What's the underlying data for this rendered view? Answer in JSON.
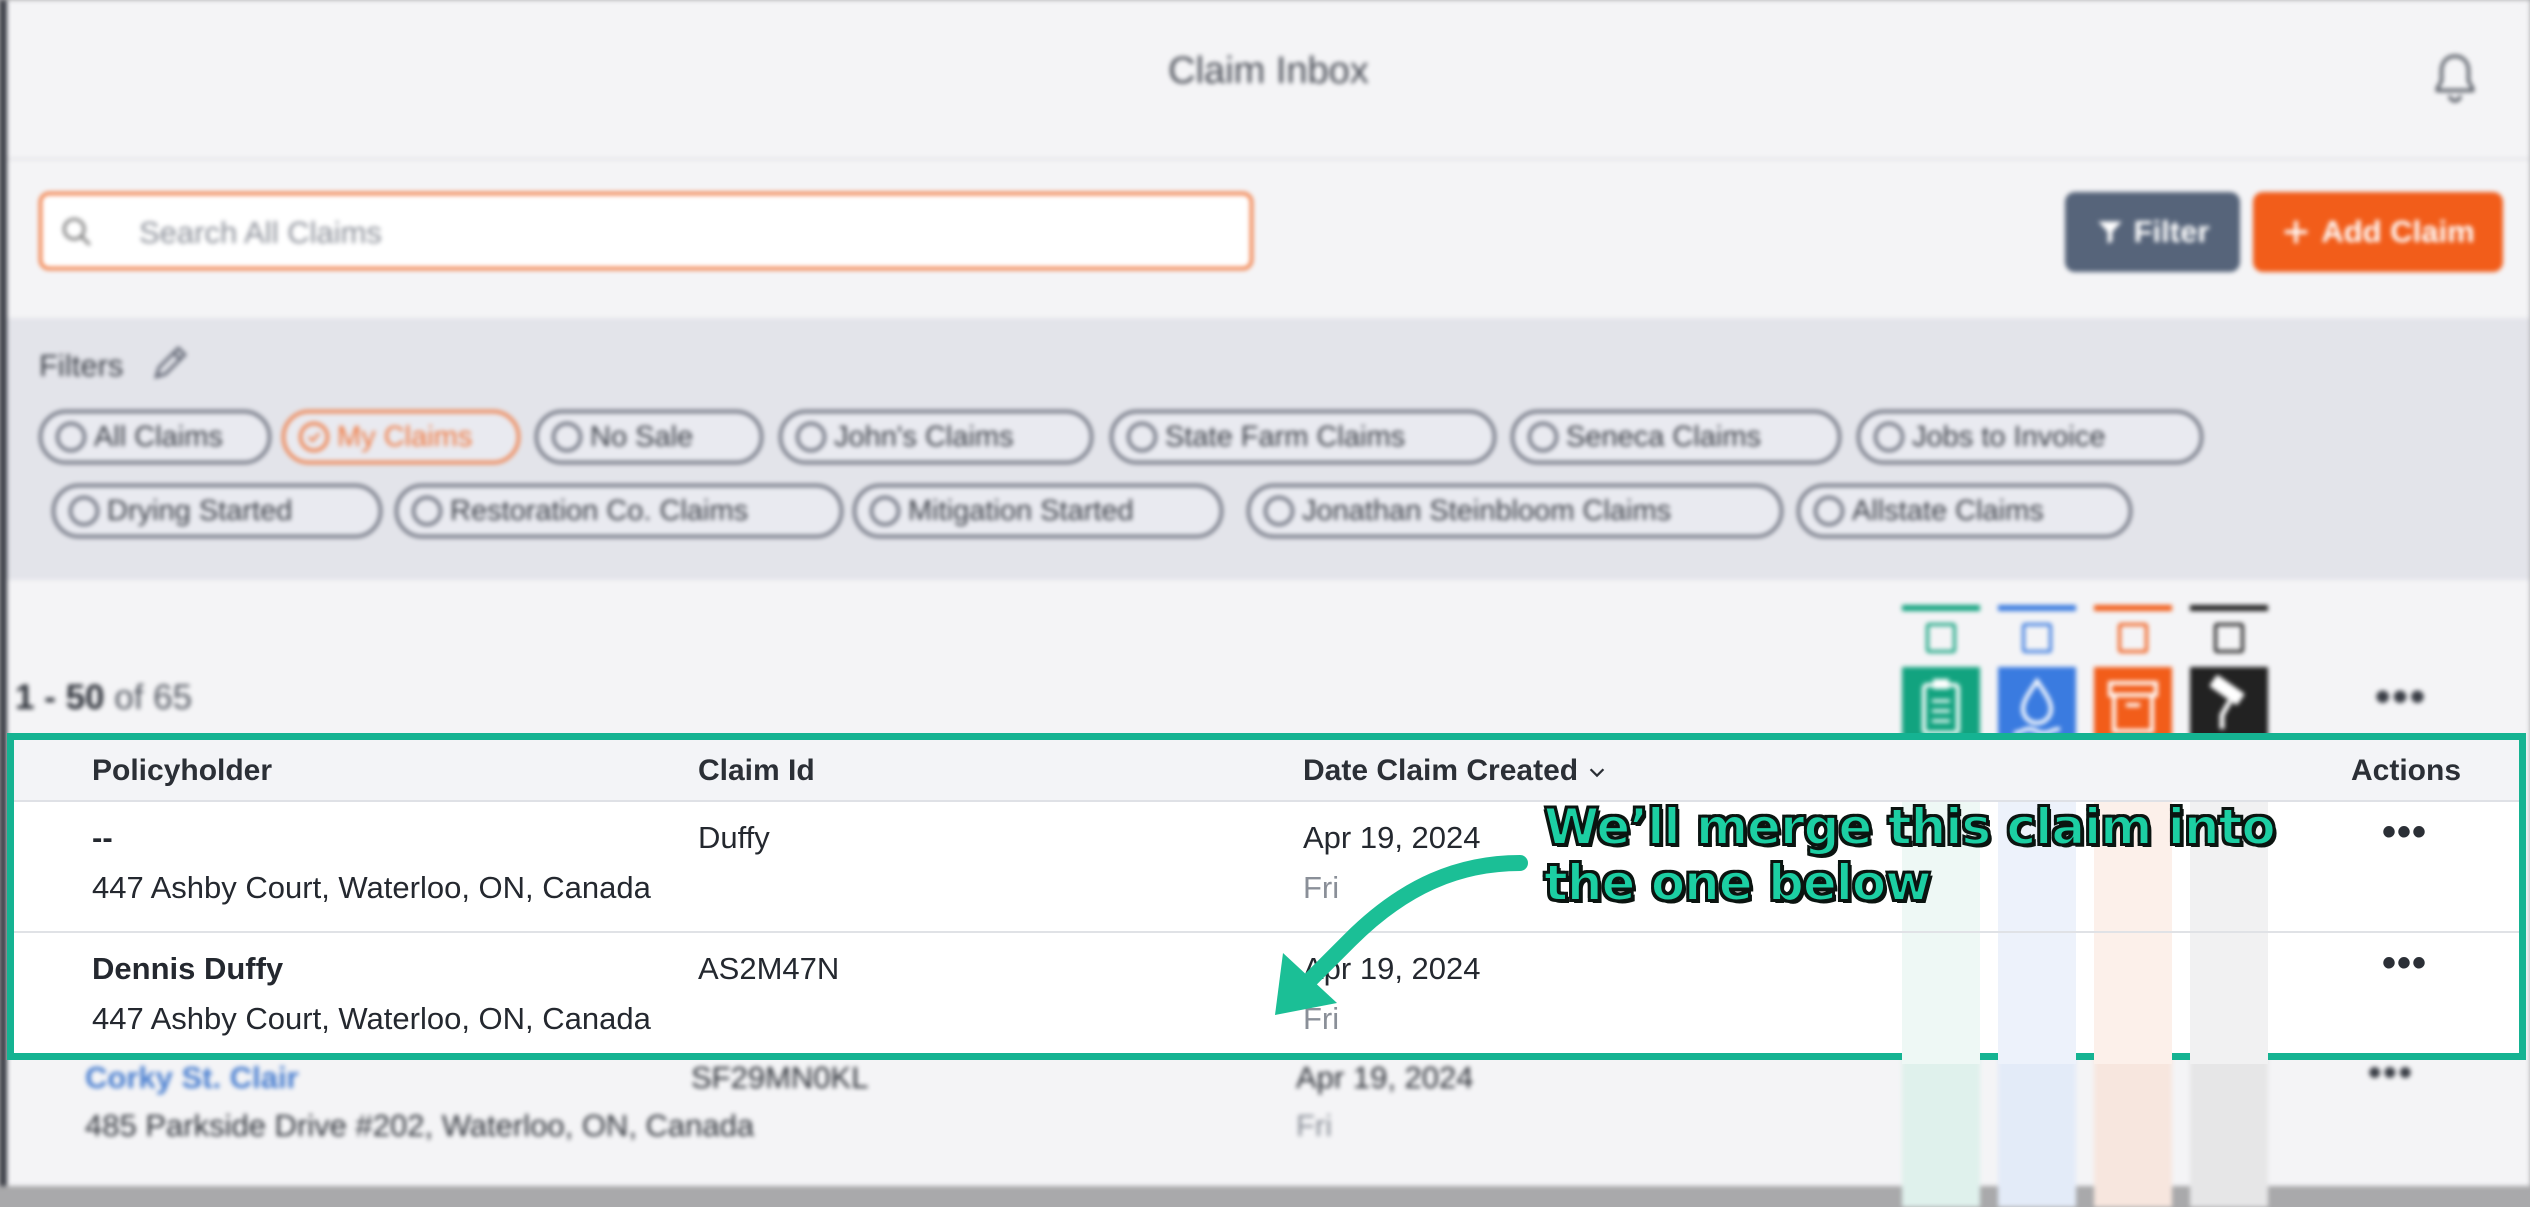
{
  "header": {
    "title": "Claim Inbox"
  },
  "search": {
    "placeholder": "Search All Claims"
  },
  "toolbar": {
    "filter_label": "Filter",
    "add_label": "Add Claim"
  },
  "filters": {
    "label": "Filters",
    "chips": [
      {
        "label": "All Claims",
        "active": false
      },
      {
        "label": "My Claims",
        "active": true
      },
      {
        "label": "No Sale",
        "active": false
      },
      {
        "label": "John's Claims",
        "active": false
      },
      {
        "label": "State Farm Claims",
        "active": false
      },
      {
        "label": "Seneca Claims",
        "active": false
      },
      {
        "label": "Jobs to Invoice",
        "active": false
      },
      {
        "label": "Drying Started",
        "active": false
      },
      {
        "label": "Restoration Co. Claims",
        "active": false
      },
      {
        "label": "Mitigation Started",
        "active": false
      },
      {
        "label": "Jonathan Steinbloom Claims",
        "active": false
      },
      {
        "label": "Allstate Claims",
        "active": false
      }
    ]
  },
  "pagination": {
    "range": "1 - 50",
    "of_label": "of 65"
  },
  "categories": [
    {
      "icon": "clipboard-icon",
      "color": "#12a37f"
    },
    {
      "icon": "water-drop-icon",
      "color": "#3a7be0"
    },
    {
      "icon": "box-icon",
      "color": "#f25d1a"
    },
    {
      "icon": "paint-roller-icon",
      "color": "#222222"
    }
  ],
  "table": {
    "columns": [
      "Policyholder",
      "Claim Id",
      "Date Claim Created",
      "Actions"
    ],
    "rows": [
      {
        "name": "--",
        "address": "447 Ashby Court, Waterloo, ON, Canada",
        "claim_id": "Duffy",
        "date": "Apr 19, 2024",
        "day": "Fri",
        "linked": false
      },
      {
        "name": "Dennis Duffy",
        "address": "447 Ashby Court, Waterloo, ON, Canada",
        "claim_id": "AS2M47N",
        "date": "Apr 19, 2024",
        "day": "Fri",
        "linked": true
      },
      {
        "name": "Corky St. Clair",
        "address": "485 Parkside Drive #202, Waterloo, ON, Canada",
        "claim_id": "SF29MN0KL",
        "date": "Apr 19, 2024",
        "day": "Fri",
        "linked": true
      }
    ]
  },
  "annotation": {
    "line1": "We’ll merge this claim into",
    "line2": "the one below"
  },
  "colors": {
    "accent": "#f25d1a",
    "highlight": "#15b392",
    "link": "#4a7fd0"
  }
}
